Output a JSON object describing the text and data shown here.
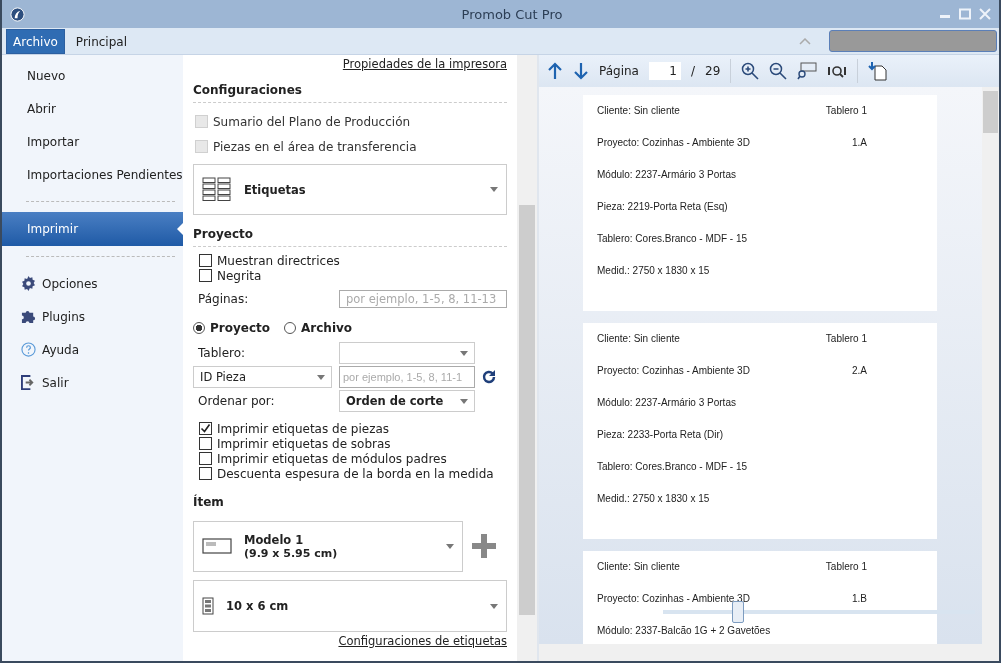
{
  "window": {
    "title": "Promob Cut Pro"
  },
  "ribbon": {
    "tabs": [
      {
        "label": "Archivo",
        "selected": true
      },
      {
        "label": "Principal",
        "selected": false
      }
    ]
  },
  "sidebar": {
    "groups": [
      [
        {
          "label": "Nuevo",
          "kind": "plain",
          "selected": false
        },
        {
          "label": "Abrir",
          "kind": "plain",
          "selected": false
        },
        {
          "label": "Importar",
          "kind": "plain",
          "selected": false
        },
        {
          "label": "Importaciones Pendientes",
          "kind": "plain",
          "selected": false
        }
      ],
      [
        {
          "label": "Imprimir",
          "kind": "plain",
          "selected": true
        }
      ],
      [
        {
          "label": "Opciones",
          "kind": "gear",
          "selected": false
        },
        {
          "label": "Plugins",
          "kind": "puzzle",
          "selected": false
        },
        {
          "label": "Ayuda",
          "kind": "help",
          "selected": false
        },
        {
          "label": "Salir",
          "kind": "exit",
          "selected": false
        }
      ]
    ]
  },
  "settings": {
    "printer_link": "Propiedades de la impresora",
    "config": {
      "heading": "Configuraciones",
      "checkboxes": [
        {
          "label": "Sumario del Plano de Producción",
          "checked": false,
          "disabled": true
        },
        {
          "label": "Piezas en el área de transferencia",
          "checked": false,
          "disabled": true
        }
      ],
      "report_type": "Etiquetas"
    },
    "project": {
      "heading": "Proyecto",
      "checkboxes": [
        {
          "label": "Muestran directrices",
          "checked": false,
          "disabled": false
        },
        {
          "label": "Negrita",
          "checked": false,
          "disabled": false
        }
      ],
      "pages_label": "Páginas:",
      "pages_placeholder": "por ejemplo, 1-5, 8, 11-13",
      "radios": [
        {
          "label": "Proyecto",
          "selected": true
        },
        {
          "label": "Archivo",
          "selected": false
        }
      ],
      "board_label": "Tablero:",
      "id_select": "ID Pieza",
      "id_placeholder": "por ejemplo, 1-5, 8, 11-1",
      "order_label": "Ordenar por:",
      "order_select": "Orden de corte",
      "print_options": [
        {
          "label": "Imprimir etiquetas de piezas",
          "checked": true
        },
        {
          "label": "Imprimir etiquetas de sobras",
          "checked": false
        },
        {
          "label": "Imprimir etiquetas de módulos padres",
          "checked": false
        },
        {
          "label": "Descuenta espesura de la borda en la medida",
          "checked": false
        }
      ]
    },
    "item": {
      "heading": "Ítem",
      "model_name": "Modelo 1",
      "model_size": "(9.9 x 5.95 cm)",
      "paper": "10 x 6 cm"
    },
    "footer_link": "Configuraciones de etiquetas"
  },
  "preview": {
    "toolbar": {
      "page_label": "Página",
      "page": "1",
      "separator": "/",
      "total": "29"
    },
    "labels": [
      {
        "lines": [
          {
            "left": "Cliente: Sin cliente",
            "right": "Tablero 1"
          },
          {
            "left": "Proyecto: Cozinhas - Ambiente 3D",
            "right": "1.A"
          },
          {
            "left": "Módulo: 2237-Armário 3 Portas"
          },
          {
            "left": "Pieza: 2219-Porta Reta (Esq)"
          },
          {
            "left": "Tablero: Cores.Branco - MDF - 15"
          },
          {
            "left": "Medid.: 2750 x 1830 x 15"
          }
        ]
      },
      {
        "lines": [
          {
            "left": "Cliente: Sin cliente",
            "right": "Tablero 1"
          },
          {
            "left": "Proyecto: Cozinhas - Ambiente 3D",
            "right": "2.A"
          },
          {
            "left": "Módulo: 2237-Armário 3 Portas"
          },
          {
            "left": "Pieza: 2233-Porta Reta (Dir)"
          },
          {
            "left": "Tablero: Cores.Branco - MDF - 15"
          },
          {
            "left": "Medid.: 2750 x 1830 x 15"
          }
        ]
      },
      {
        "lines": [
          {
            "left": "Cliente: Sin cliente",
            "right": "Tablero 1"
          },
          {
            "left": "Proyecto: Cozinhas - Ambiente 3D",
            "right": "1.B"
          },
          {
            "left": "Módulo: 2337-Balcão 1G + 2 Gavetões"
          }
        ]
      }
    ],
    "zoom": {
      "level": 0.23
    }
  }
}
